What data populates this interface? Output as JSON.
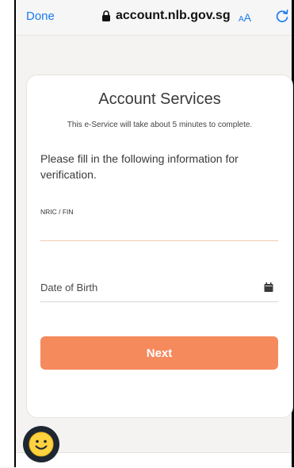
{
  "browser": {
    "done_label": "Done",
    "url": "account.nlb.gov.sg",
    "text_size_label_small": "A",
    "text_size_label_large": "A",
    "accent_color": "#1b7cf0"
  },
  "card": {
    "title": "Account Services",
    "subtitle": "This e-Service will take about 5 minutes to complete.",
    "instructions": "Please fill in the following information for verification.",
    "nric_label": "NRIC / FIN",
    "nric_value": "",
    "dob_placeholder": "Date of Birth",
    "next_label": "Next",
    "button_color": "#f58a5d"
  },
  "icons": {
    "lock": "lock-icon",
    "reload": "reload-icon",
    "calendar": "calendar-icon",
    "chat": "smiley-chat-icon"
  }
}
